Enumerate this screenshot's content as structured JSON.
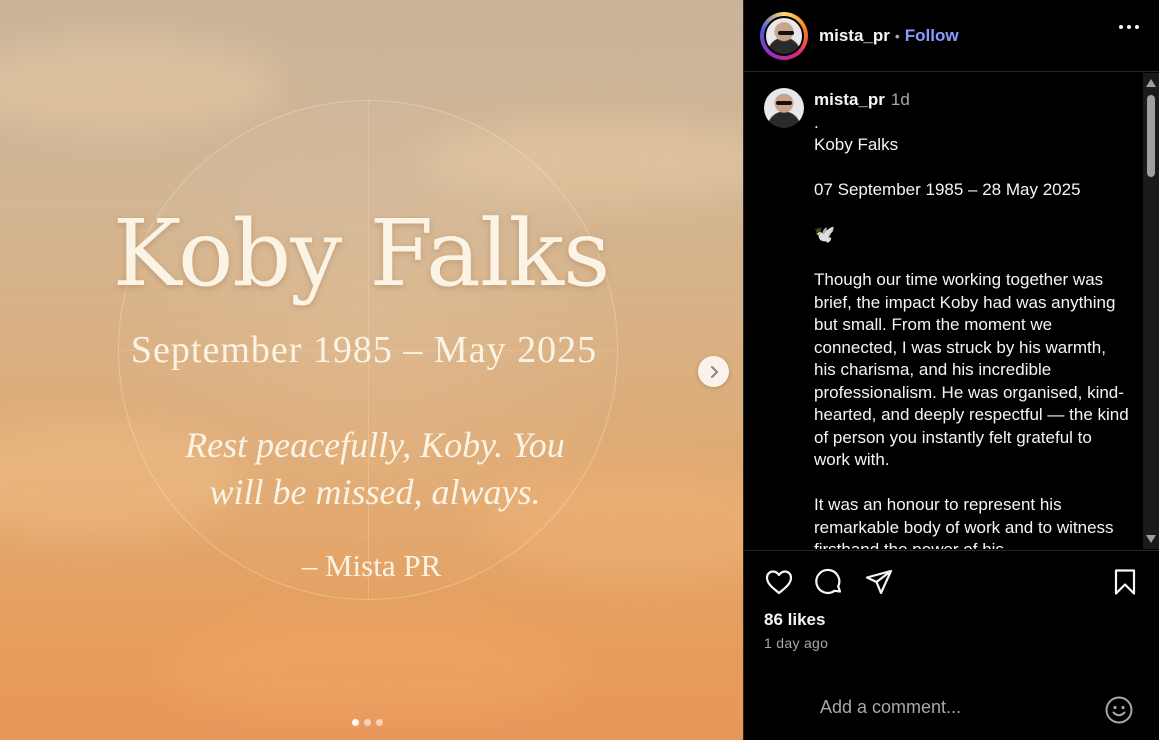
{
  "media": {
    "name": "Koby Falks",
    "dates": "September 1985 – May 2025",
    "quote": "Rest peacefully, Koby. You will be missed, always.",
    "signature": "– Mista PR",
    "slide_count": 3,
    "active_slide": 1
  },
  "header": {
    "username": "mista_pr",
    "separator": "•",
    "follow_label": "Follow"
  },
  "caption": {
    "username": "mista_pr",
    "time": "1d",
    "lines": [
      ".",
      "Koby Falks",
      "",
      "07 September 1985 – 28 May 2025",
      "",
      "🕊️",
      "",
      "Though our time working together was brief, the impact Koby had was anything but small. From the moment we connected, I was struck by his warmth, his charisma, and his incredible professionalism. He was organised, kind-hearted, and deeply respectful — the kind of person you instantly felt grateful to work with.",
      "",
      "It was an honour to represent his remarkable body of work and to witness firsthand the power of his"
    ]
  },
  "actions": {
    "likes": "86 likes",
    "time_ago": "1 day ago",
    "comment_placeholder": "Add a comment..."
  },
  "colors": {
    "follow": "#8a9dff",
    "background": "#000000",
    "text": "#f5f5f5",
    "muted": "#a8a8a8"
  }
}
